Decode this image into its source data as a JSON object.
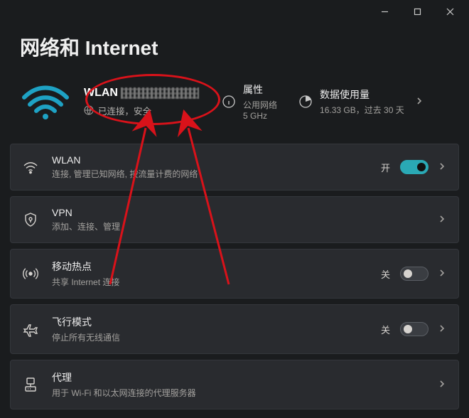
{
  "page": {
    "title": "网络和 Internet"
  },
  "hero": {
    "ssid_prefix": "WLAN",
    "status": "已连接，安全",
    "properties_title": "属性",
    "properties_sub1": "公用网络",
    "properties_sub2": "5 GHz",
    "usage_title": "数据使用量",
    "usage_sub": "16.33 GB，过去 30 天"
  },
  "cards": {
    "wlan": {
      "title": "WLAN",
      "sub": "连接, 管理已知网络, 按流量计费的网络",
      "state": "开"
    },
    "vpn": {
      "title": "VPN",
      "sub": "添加、连接、管理"
    },
    "hotspot": {
      "title": "移动热点",
      "sub": "共享 Internet 连接",
      "state": "关"
    },
    "airplane": {
      "title": "飞行模式",
      "sub": "停止所有无线通信",
      "state": "关"
    },
    "proxy": {
      "title": "代理",
      "sub": "用于 Wi-Fi 和以太网连接的代理服务器"
    }
  }
}
